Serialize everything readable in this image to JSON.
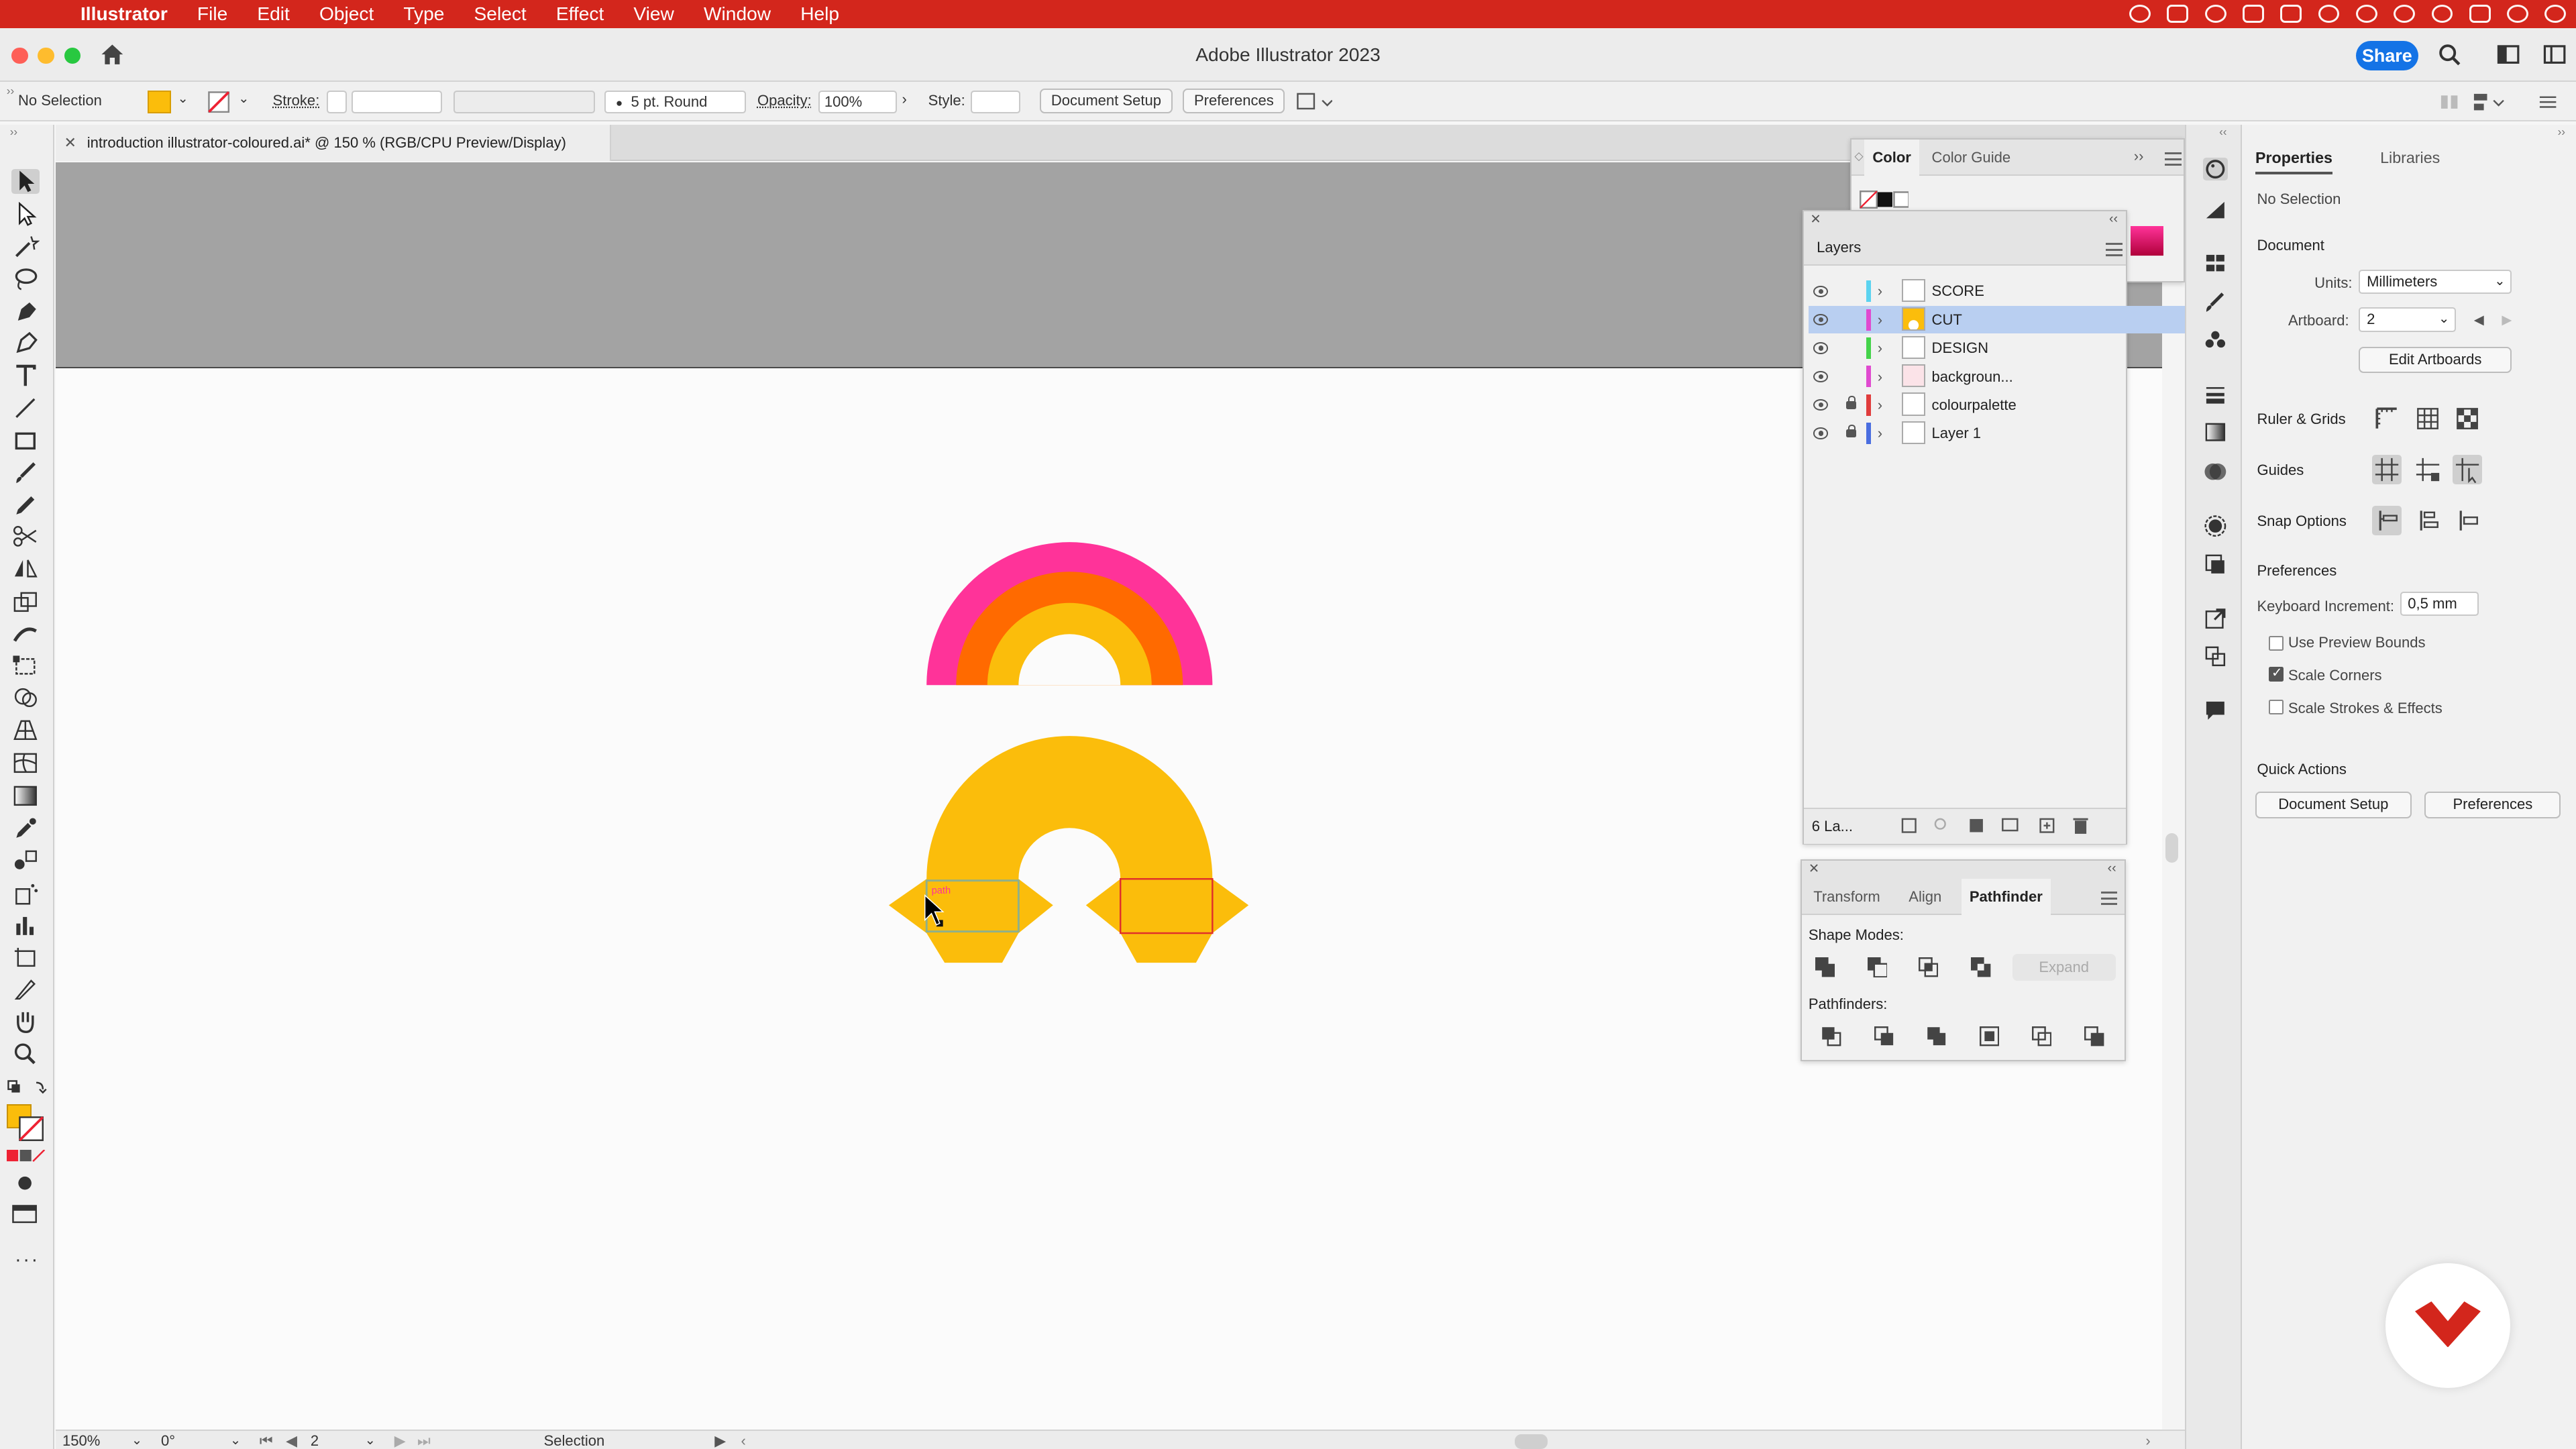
{
  "menubar": {
    "app": "Illustrator",
    "items": [
      "File",
      "Edit",
      "Object",
      "Type",
      "Select",
      "Effect",
      "View",
      "Window",
      "Help"
    ]
  },
  "window": {
    "title": "Adobe Illustrator 2023",
    "share_label": "Share"
  },
  "controlbar": {
    "selection": "No Selection",
    "stroke_label": "Stroke:",
    "brush": "5 pt. Round",
    "opacity_label": "Opacity:",
    "opacity": "100%",
    "style_label": "Style:",
    "document_setup": "Document Setup",
    "preferences": "Preferences"
  },
  "document": {
    "tab_title": "introduction illustrator-coloured.ai* @ 150 % (RGB/CPU Preview/Display)"
  },
  "canvas": {
    "path_tooltip": "path"
  },
  "colors": {
    "accent_red": "#d3261c",
    "yellow": "#fbbd0b",
    "orange": "#ff6a00",
    "pink": "#ff3399",
    "selection_blue": "#1473e6"
  },
  "color_panel": {
    "tabs": [
      "Color",
      "Color Guide"
    ]
  },
  "layers_panel": {
    "title": "Layers",
    "count": "6 La...",
    "layers": [
      {
        "name": "SCORE",
        "color": "#5bd3f0",
        "locked": false,
        "selected": false
      },
      {
        "name": "CUT",
        "color": "#e04ad0",
        "locked": false,
        "selected": true
      },
      {
        "name": "DESIGN",
        "color": "#44d34a",
        "locked": false,
        "selected": false
      },
      {
        "name": "backgroun...",
        "color": "#e04ad0",
        "locked": false,
        "selected": false
      },
      {
        "name": "colourpalette",
        "color": "#e03c3c",
        "locked": true,
        "selected": false
      },
      {
        "name": "Layer 1",
        "color": "#4a6ee0",
        "locked": true,
        "selected": false
      }
    ]
  },
  "pathfinder_panel": {
    "tabs": [
      "Transform",
      "Align",
      "Pathfinder"
    ],
    "shape_modes": "Shape Modes:",
    "expand": "Expand",
    "pathfinders": "Pathfinders:"
  },
  "properties_panel": {
    "tabs": [
      "Properties",
      "Libraries"
    ],
    "selection": "No Selection",
    "document_heading": "Document",
    "units_label": "Units:",
    "units_value": "Millimeters",
    "artboard_label": "Artboard:",
    "artboard_value": "2",
    "edit_artboards": "Edit Artboards",
    "ruler_grids": "Ruler & Grids",
    "guides": "Guides",
    "snap_options": "Snap Options",
    "preferences_heading": "Preferences",
    "keyboard_increment_label": "Keyboard Increment:",
    "keyboard_increment_value": "0,5 mm",
    "use_preview_bounds": "Use Preview Bounds",
    "use_preview_bounds_checked": false,
    "scale_corners": "Scale Corners",
    "scale_corners_checked": true,
    "scale_strokes_effects": "Scale Strokes & Effects",
    "scale_strokes_effects_checked": false,
    "quick_actions": "Quick Actions",
    "document_setup": "Document Setup",
    "preferences": "Preferences"
  },
  "statusbar": {
    "zoom": "150%",
    "rotation": "0°",
    "artboard": "2",
    "tool": "Selection"
  }
}
